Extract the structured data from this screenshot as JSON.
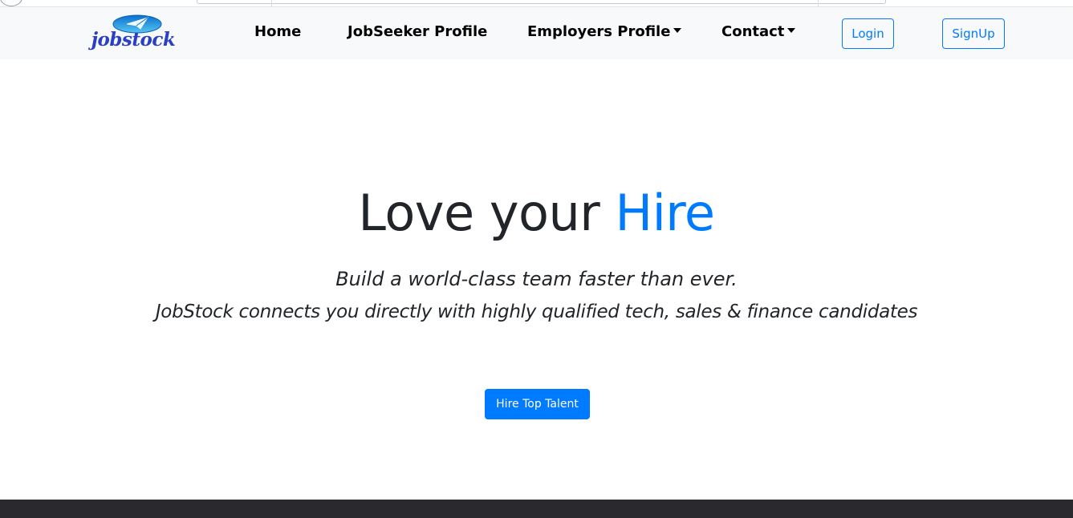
{
  "brand": {
    "logo_text": "jobstock",
    "logo_colors": {
      "text": "#2b3fc4",
      "badge": "#0c7fd6",
      "badge_light": "#5cc9f0"
    }
  },
  "nav": {
    "home": "Home",
    "jobseeker_profile": "JobSeeker Profile",
    "employers_profile": "Employers Profile",
    "contact": "Contact",
    "login": "Login",
    "signup": "SignUp"
  },
  "hero": {
    "title_main": "Love your ",
    "title_accent": "Hire",
    "subtitle_line1": "Build a world-class team faster than ever.",
    "subtitle_line2": "JobStock connects you directly with highly qualified tech, sales & finance candidates",
    "cta_label": "Hire Top Talent"
  },
  "colors": {
    "accent": "#007bff",
    "navbar_bg": "#f8f9fa",
    "footer_bg": "#29292e",
    "text": "#212529"
  }
}
